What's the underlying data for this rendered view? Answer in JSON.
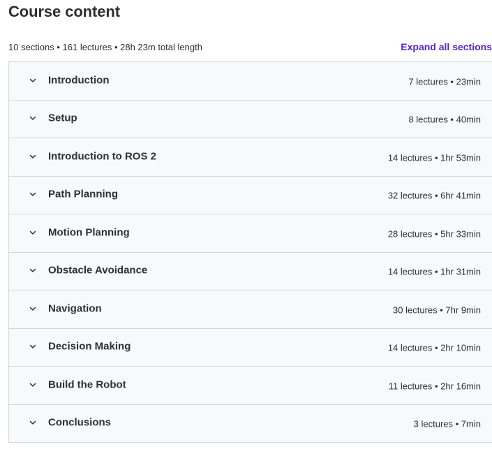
{
  "header": {
    "title": "Course content",
    "summary": "10 sections • 161 lectures • 28h 23m total length",
    "expand_label": "Expand all sections"
  },
  "icons": {
    "section_toggle": "chevron-down-icon"
  },
  "colors": {
    "accent": "#5624d0",
    "row_bg": "#f7f9fa",
    "border": "#d1d7dc",
    "text": "#2d2f31"
  },
  "sections": [
    {
      "title": "Introduction",
      "meta": "7 lectures • 23min"
    },
    {
      "title": "Setup",
      "meta": "8 lectures • 40min"
    },
    {
      "title": "Introduction to ROS 2",
      "meta": "14 lectures • 1hr 53min"
    },
    {
      "title": "Path Planning",
      "meta": "32 lectures • 6hr 41min"
    },
    {
      "title": "Motion Planning",
      "meta": "28 lectures • 5hr 33min"
    },
    {
      "title": "Obstacle Avoidance",
      "meta": "14 lectures • 1hr 31min"
    },
    {
      "title": "Navigation",
      "meta": "30 lectures • 7hr 9min"
    },
    {
      "title": "Decision Making",
      "meta": "14 lectures • 2hr 10min"
    },
    {
      "title": "Build the Robot",
      "meta": "11 lectures • 2hr 16min"
    },
    {
      "title": "Conclusions",
      "meta": "3 lectures • 7min"
    }
  ]
}
